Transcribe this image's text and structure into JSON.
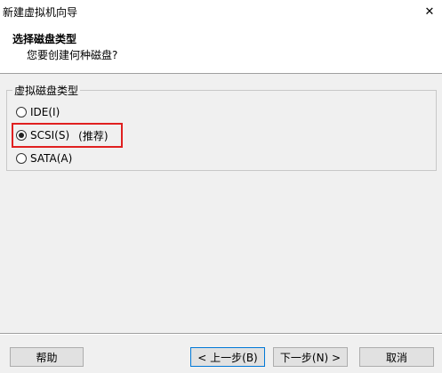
{
  "window": {
    "title": "新建虚拟机向导",
    "close_symbol": "✕"
  },
  "header": {
    "title": "选择磁盘类型",
    "subtitle": "您要创建何种磁盘?"
  },
  "group": {
    "label": "虚拟磁盘类型",
    "options": [
      {
        "label": "IDE(I)",
        "checked": false
      },
      {
        "label": "SCSI(S)",
        "checked": true,
        "note": "(推荐)"
      },
      {
        "label": "SATA(A)",
        "checked": false
      }
    ]
  },
  "buttons": {
    "help": "帮助",
    "back": "< 上一步(B)",
    "next": "下一步(N) >",
    "cancel": "取消"
  },
  "colors": {
    "highlight": "#e02020",
    "focus": "#0078d7"
  }
}
